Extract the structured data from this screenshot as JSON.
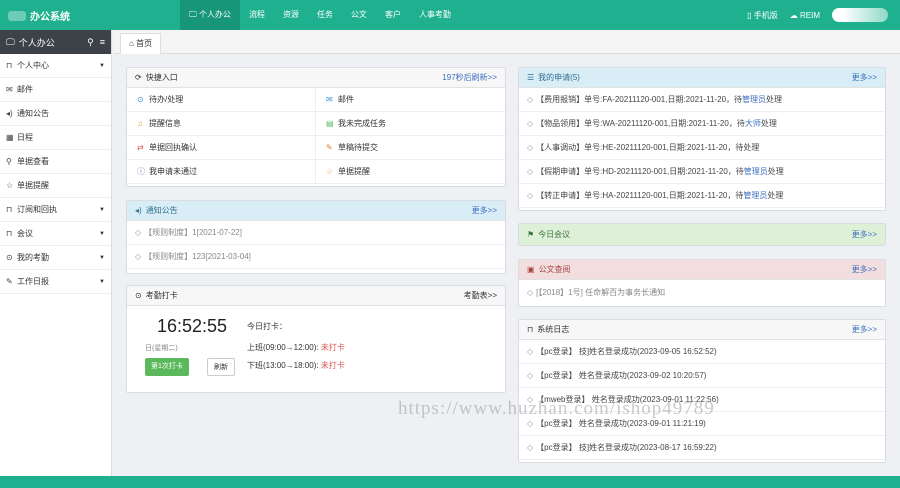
{
  "topbar": {
    "title": "办公系统",
    "nav": [
      {
        "icon": "monitor-icon",
        "label": "个人办公"
      },
      {
        "label": "流程"
      },
      {
        "label": "资源"
      },
      {
        "label": "任务"
      },
      {
        "label": "公文"
      },
      {
        "label": "客户"
      },
      {
        "label": "人事考勤"
      }
    ],
    "mobile": "手机版",
    "reim": "REIM"
  },
  "sidebar": {
    "header": "个人办公",
    "items": [
      {
        "icon": "bookmark-icon",
        "label": "个人中心",
        "caret": true
      },
      {
        "icon": "envelope-icon",
        "label": "邮件"
      },
      {
        "icon": "speaker-icon",
        "label": "通知公告"
      },
      {
        "icon": "calendar-icon",
        "label": "日程"
      },
      {
        "icon": "search-icon",
        "label": "单据查看"
      },
      {
        "icon": "star-icon",
        "label": "单据提醒"
      },
      {
        "icon": "bookmark-icon",
        "label": "订阅和回执",
        "caret": true
      },
      {
        "icon": "bookmark-icon",
        "label": "会议",
        "caret": true
      },
      {
        "icon": "clock-icon",
        "label": "我的考勤",
        "caret": true
      },
      {
        "icon": "edit-icon",
        "label": "工作日报",
        "caret": true
      }
    ]
  },
  "tab": {
    "label": "首页"
  },
  "quick": {
    "title": "快捷入口",
    "refresh": "197秒后刷新>>",
    "items": [
      {
        "icon": "clock-icon",
        "label": "待办/处理"
      },
      {
        "icon": "envelope-icon",
        "label": "邮件"
      },
      {
        "icon": "bell-icon",
        "label": "提醒信息"
      },
      {
        "icon": "book-icon",
        "label": "我未完成任务"
      },
      {
        "icon": "exchange-icon",
        "label": "单据回执确认"
      },
      {
        "icon": "edit-icon",
        "label": "草稿待提交"
      },
      {
        "icon": "info-icon",
        "label": "我申请未通过"
      },
      {
        "icon": "star-icon",
        "label": "单据提醒"
      }
    ]
  },
  "notice": {
    "title": "通知公告",
    "more": "更多>>",
    "items": [
      "【规则制度】1[2021-07-22]",
      "【规则制度】123[2021-03-04]"
    ]
  },
  "attendance": {
    "title": "考勤打卡",
    "link": "考勤表>>",
    "time": "16:52:55",
    "date": "日(星期二)",
    "today": "今日打卡：",
    "morning": "上班(09:00→12:00):",
    "afternoon": "下班(13:00→18:00):",
    "status": "未打卡",
    "punch_button": "第1次打卡",
    "refresh_button": "刷新"
  },
  "applications": {
    "title": "我的申请(5)",
    "more": "更多>>",
    "items": [
      {
        "text": "【费用报销】单号:FA-20211120-001,日期:2021-11-20，待",
        "link": "管理员",
        "tail": "处理"
      },
      {
        "text": "【物品领用】单号:WA-20211120-001,日期:2021-11-20，待",
        "link": "大师",
        "tail": "处理"
      },
      {
        "text": "【人事调动】单号:HE-20211120-001,日期:2021-11-20，待处理",
        "link": "",
        "tail": ""
      },
      {
        "text": "【假期申请】单号:HD-20211120-001,日期:2021-11-20，待",
        "link": "管理员",
        "tail": "处理"
      },
      {
        "text": "【转正申请】单号:HA-20211120-001,日期:2021-11-20，待",
        "link": "管理员",
        "tail": "处理"
      }
    ]
  },
  "meeting": {
    "title": "今日会议",
    "more": "更多>>"
  },
  "docs": {
    "title": "公文查阅",
    "more": "更多>>",
    "items": [
      "[【2018】1号] 任命解百为事务长通知"
    ]
  },
  "syslog": {
    "title": "系统日志",
    "more": "更多>>",
    "items": [
      "【pc登录】 技]姓名登录成功(2023-09-05 16:52:52)",
      "【pc登录】 姓名登录成功(2023-09-02 10:20:57)",
      "【mweb登录】 姓名登录成功(2023-09-01 11:22:56)",
      "【pc登录】 姓名登录成功(2023-09-01 11:21:19)",
      "【pc登录】 技]姓名登录成功(2023-08-17 16:59:22)"
    ]
  },
  "watermark": "https://www.huzhan.com/ishop49789",
  "colors": {
    "brand": "#1fb18f",
    "sidebar_head": "#3c4247",
    "link": "#3b6fbf",
    "warn": "#d9534f"
  }
}
